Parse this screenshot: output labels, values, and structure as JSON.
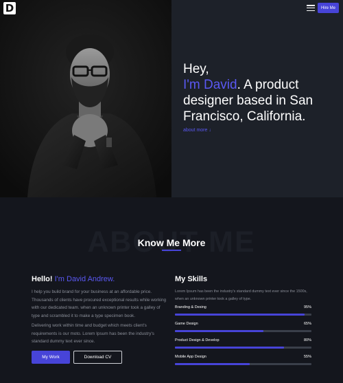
{
  "brand": {
    "logo_letter": "D"
  },
  "header": {
    "menu_icon": "hamburger-icon",
    "hire_label": "Hire Me"
  },
  "hero": {
    "greeting": "Hey,",
    "name_highlight": "I'm David",
    "headline_rest": ". A product designer based in San Francisco, California.",
    "about_link_label": "about more",
    "about_link_icon": "↓"
  },
  "about": {
    "watermark": "ABOUT ME",
    "title": "Know Me More",
    "hello_prefix": "Hello!",
    "hello_name": "I'm David Andrew.",
    "paragraph_1": "I help you build brand for your business at an affordable price. Thousands of clients have procured exceptional results while working with our dedicated team. when an unknown printer took a galley of type and scrambled it to make a type specimen book.",
    "paragraph_2": "Delivering work within time and budget which meets client's requirements is our moto. Lorem Ipsum has been the industry's standard dummy text ever since.",
    "primary_button": "My Work",
    "secondary_button": "Download CV"
  },
  "skills": {
    "title": "My Skills",
    "description": "Lorem Ipsum has been the industry's standard dummy text ever since the 1500s, when an unknown printer took a galley of type.",
    "items": [
      {
        "label": "Branding & Desing",
        "percent": 95,
        "percent_text": "95%"
      },
      {
        "label": "Game Design",
        "percent": 65,
        "percent_text": "65%"
      },
      {
        "label": "Product Design & Develop",
        "percent": 80,
        "percent_text": "80%"
      },
      {
        "label": "Mobile App Design",
        "percent": 55,
        "percent_text": "55%"
      }
    ]
  },
  "colors": {
    "accent": "#4744d8",
    "accent_text": "#5a58f2",
    "hero_bg": "#1d2129",
    "page_bg": "#14161d"
  }
}
